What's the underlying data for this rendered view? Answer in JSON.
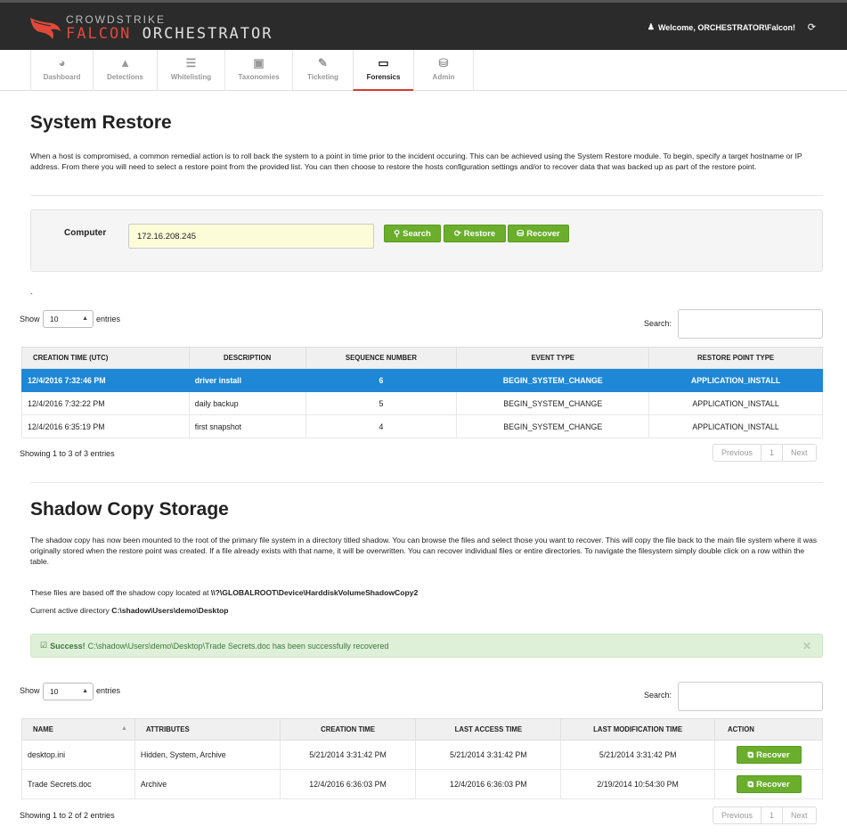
{
  "header": {
    "logo_line1": "CROWDSTRIKE",
    "logo_line2_red": "FALCON",
    "logo_line2_rest": "ORCHESTRATOR",
    "welcome": "Welcome, ORCHESTRATOR\\Falcon!"
  },
  "nav": {
    "tabs": [
      {
        "label": "Dashboard",
        "icon": "dashboard-icon"
      },
      {
        "label": "Detections",
        "icon": "warning-icon"
      },
      {
        "label": "Whitelisting",
        "icon": "list-icon"
      },
      {
        "label": "Taxonomies",
        "icon": "taxonomy-icon"
      },
      {
        "label": "Ticketing",
        "icon": "ticket-icon"
      },
      {
        "label": "Forensics",
        "icon": "monitor-icon"
      },
      {
        "label": "Admin",
        "icon": "database-icon"
      }
    ],
    "active": "Forensics"
  },
  "system_restore": {
    "title": "System Restore",
    "description": "When a host is compromised, a common remedial action is to roll back the system to a point in time prior to the incident occuring. This can be achieved using the System Restore module. To begin, specify a target hostname or IP address. From there you will need to select a restore point from the provided list. You can then choose to restore the hosts configuration settings and/or to recover data that was backed up as part of the restore point.",
    "computer_label": "Computer",
    "computer_value": "172.16.208.245",
    "search_btn": "Search",
    "restore_btn": "Restore",
    "recover_btn": "Recover",
    "dot": "`",
    "show": "Show",
    "page_size": "10",
    "entries": "entries",
    "search_label": "Search:",
    "columns": [
      "CREATION TIME (UTC)",
      "DESCRIPTION",
      "SEQUENCE NUMBER",
      "EVENT TYPE",
      "RESTORE POINT TYPE"
    ],
    "rows": [
      [
        "12/4/2016 7:32:46 PM",
        "driver install",
        "6",
        "BEGIN_SYSTEM_CHANGE",
        "APPLICATION_INSTALL"
      ],
      [
        "12/4/2016 7:32:22 PM",
        "daily backup",
        "5",
        "BEGIN_SYSTEM_CHANGE",
        "APPLICATION_INSTALL"
      ],
      [
        "12/4/2016 6:35:19 PM",
        "first snapshot",
        "4",
        "BEGIN_SYSTEM_CHANGE",
        "APPLICATION_INSTALL"
      ]
    ],
    "selected_row": 0,
    "info": "Showing 1 to 3 of 3 entries",
    "pager": {
      "previous": "Previous",
      "page": "1",
      "next": "Next"
    }
  },
  "shadow_copy": {
    "title": "Shadow Copy Storage",
    "description": "The shadow copy has now been mounted to the root of the primary file system in a directory titled shadow. You can browse the files and select those you want to recover. This will copy the file back to the main file system where it was originally stored when the restore point was created. If a file already exists with that name, it will be overwritten. You can recover individual files or entire directories. To navigate the filesystem simply double click on a row within the table.",
    "based_prefix": "These files are based off the shadow copy located at",
    "based_path": "\\\\?\\GLOBALROOT\\Device\\HarddiskVolumeShadowCopy2",
    "current_prefix": "Current active directory",
    "current_path": "C:\\shadow\\Users\\demo\\Desktop",
    "alert_strong": "Success!",
    "alert_text": "C:\\shadow\\Users\\demo\\Desktop\\Trade Secrets.doc has been successfully recovered",
    "show": "Show",
    "page_size": "10",
    "entries": "entries",
    "search_label": "Search:",
    "columns": [
      "NAME",
      "ATTRIBUTES",
      "CREATION TIME",
      "LAST ACCESS TIME",
      "LAST MODIFICATION TIME",
      "ACTION"
    ],
    "rows": [
      {
        "name": "desktop.ini",
        "attributes": "Hidden, System, Archive",
        "created": "5/21/2014 3:31:42 PM",
        "accessed": "5/21/2014 3:31:42 PM",
        "modified": "5/21/2014 3:31:42 PM",
        "action": "Recover"
      },
      {
        "name": "Trade Secrets.doc",
        "attributes": "Archive",
        "created": "12/4/2016 6:36:03 PM",
        "accessed": "12/4/2016 6:36:03 PM",
        "modified": "2/19/2014 10:54:30 PM",
        "action": "Recover"
      }
    ],
    "info": "Showing 1 to 2 of 2 entries",
    "pager": {
      "previous": "Previous",
      "page": "1",
      "next": "Next"
    }
  },
  "colors": {
    "accent_green": "#6aae2c",
    "selected_blue": "#1e87d6",
    "active_tab_red": "#d93a2b",
    "header_bg": "#2b2b2b"
  }
}
